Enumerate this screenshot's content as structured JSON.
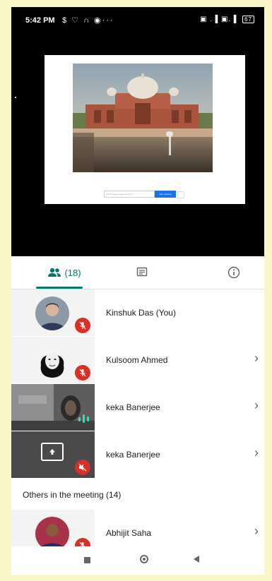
{
  "status_bar": {
    "time": "5:42 PM",
    "left_icons": "$ ♡ ∩ ◉···",
    "right_icons": "▣ .▐ ▣.▐",
    "battery": "67"
  },
  "slide": {
    "input_placeholder": "https://meet.google.com/xyz...",
    "button_label": "Join meeting"
  },
  "tabs": {
    "people_count": "(18)"
  },
  "participants": [
    {
      "name": "Kinshuk Das (You)",
      "mic": "muted"
    },
    {
      "name": "Kulsoom Ahmed",
      "mic": "muted"
    },
    {
      "name": "keka Banerjee",
      "mic": "speaking"
    },
    {
      "name": "keka Banerjee",
      "mic": "muted"
    }
  ],
  "others": {
    "label": "Others in the meeting (14)",
    "items": [
      {
        "name": "Abhijit Saha",
        "mic": "muted"
      }
    ]
  },
  "colors": {
    "accent": "#00796b",
    "mute": "#d93025",
    "speaking": "#1de9b6"
  },
  "icons": [
    "people-icon",
    "chat-icon",
    "info-icon",
    "mic-off-icon",
    "speaking-icon",
    "present-screen-icon",
    "chevron-right-icon"
  ]
}
